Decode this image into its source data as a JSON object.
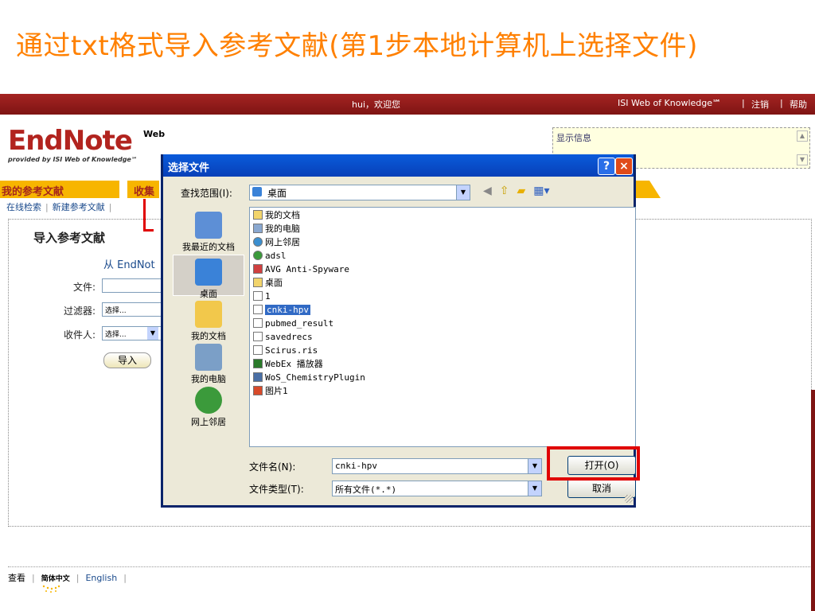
{
  "slide": {
    "title": "通过txt格式导入参考文献(第1步本地计算机上选择文件)"
  },
  "endnote": {
    "greeting": "hui，欢迎您",
    "isi_link": "ISI Web of Knowledge℠",
    "logout": "注销",
    "help": "帮助",
    "logo_text": "EndNote",
    "logo_web": "Web",
    "logo_sub": "provided by ISI Web of Knowledge℠",
    "info_label": "显示信息",
    "tabs": {
      "my_refs": "我的参考文献",
      "collect": "收集"
    },
    "subnav": {
      "online_search": "在线检索",
      "new_ref": "新建参考文献"
    },
    "panel": {
      "title": "导入参考文献",
      "from_text": "从 EndNot",
      "file_label": "文件:",
      "filter_label": "过滤器:",
      "filter_value": "选择...",
      "recipient_label": "收件人:",
      "recipient_value": "选择...",
      "import_button": "导入"
    },
    "footer": {
      "view": "查看",
      "lang_zh": "简体中文",
      "lang_en": "English"
    }
  },
  "dialog": {
    "title": "选择文件",
    "help_btn": "?",
    "close_btn": "×",
    "lookin_label": "查找范围(I):",
    "lookin_value": "桌面",
    "places": [
      {
        "label": "我最近的文档",
        "icon": "recent-documents-icon",
        "color": "#5d8fd6"
      },
      {
        "label": "桌面",
        "icon": "desktop-icon",
        "color": "#3a82d8"
      },
      {
        "label": "我的文档",
        "icon": "my-documents-folder-icon",
        "color": "#f2c84b"
      },
      {
        "label": "我的电脑",
        "icon": "my-computer-icon",
        "color": "#7b9fc7"
      },
      {
        "label": "网上邻居",
        "icon": "network-places-icon",
        "color": "#3b9a3b"
      }
    ],
    "files": [
      {
        "name": "我的文档",
        "icon": "folder-icon",
        "color": "#f2d46b"
      },
      {
        "name": "我的电脑",
        "icon": "computer-icon",
        "color": "#8aa8d0"
      },
      {
        "name": "网上邻居",
        "icon": "network-icon",
        "color": "#3b8fd0"
      },
      {
        "name": "adsl",
        "icon": "connection-icon",
        "color": "#3a9a3a"
      },
      {
        "name": "AVG Anti-Spyware",
        "icon": "shortcut-icon",
        "color": "#d04040"
      },
      {
        "name": "桌面",
        "icon": "folder-icon",
        "color": "#f2d46b"
      },
      {
        "name": "1",
        "icon": "file-icon",
        "color": "#ffffff"
      },
      {
        "name": "cnki-hpv",
        "icon": "text-file-icon",
        "color": "#ffffff",
        "selected": true
      },
      {
        "name": "pubmed_result",
        "icon": "text-file-icon",
        "color": "#ffffff"
      },
      {
        "name": "savedrecs",
        "icon": "text-file-icon",
        "color": "#ffffff"
      },
      {
        "name": "Scirus.ris",
        "icon": "file-icon",
        "color": "#ffffff"
      },
      {
        "name": "WebEx 播放器",
        "icon": "webex-icon",
        "color": "#2a7a2a"
      },
      {
        "name": "WoS_ChemistryPlugin",
        "icon": "shortcut-icon",
        "color": "#4a6fa5"
      },
      {
        "name": "图片1",
        "icon": "image-file-icon",
        "color": "#d84a2a"
      }
    ],
    "filename_label": "文件名(N):",
    "filename_value": "cnki-hpv",
    "filetype_label": "文件类型(T):",
    "filetype_value": "所有文件(*.*)",
    "open_button": "打开(O)",
    "cancel_button": "取消"
  }
}
